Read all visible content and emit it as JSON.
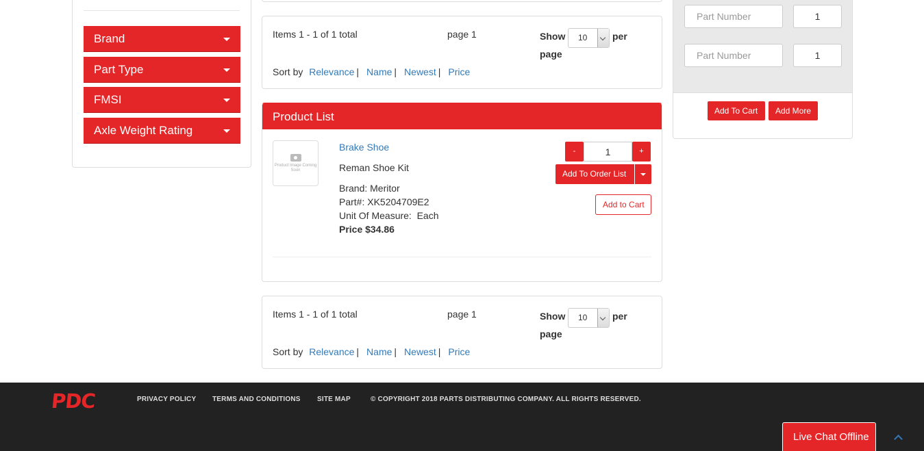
{
  "sidebar": {
    "facets": [
      {
        "label": "Brand"
      },
      {
        "label": "Part Type"
      },
      {
        "label": "FMSI"
      },
      {
        "label": "Axle Weight Rating"
      }
    ]
  },
  "pager": {
    "items_text": "Items 1 - 1 of 1 total",
    "page_text": "page 1",
    "show_label": "Show",
    "per_page_value": "10",
    "per_label": "per",
    "page_label": "page",
    "sort_label": "Sort by",
    "sort_options": [
      "Relevance",
      "Name",
      "Newest",
      "Price"
    ]
  },
  "product_list": {
    "heading": "Product List",
    "thumb_caption": "Product Image Coming Soon",
    "product": {
      "name": "Brake Shoe",
      "description": "Reman Shoe Kit",
      "brand": "Brand: Meritor",
      "part": "Part#: XK5204709E2",
      "uom": "Unit Of Measure:  Each",
      "price": "Price $34.86",
      "qty": "1",
      "minus": "-",
      "plus": "+",
      "order_list_label": "Add To Order List",
      "cart_label": "Add to Cart"
    }
  },
  "quick_order": {
    "rows": [
      {
        "placeholder": "Part Number",
        "qty": "1"
      },
      {
        "placeholder": "Part Number",
        "qty": "1"
      }
    ],
    "add_to_cart_label": "Add To Cart",
    "add_more_label": "Add More"
  },
  "footer": {
    "logo": "PDC",
    "links": [
      "PRIVACY POLICY",
      "TERMS AND CONDITIONS",
      "SITE MAP"
    ],
    "copyright": "© COPYRIGHT 2018 PARTS DISTRIBUTING COMPANY. ALL RIGHTS RESERVED.",
    "chat_label": "Live Chat Offline"
  },
  "colors": {
    "accent": "#e42628",
    "link": "#337ab7",
    "footer_bg": "#222222"
  }
}
